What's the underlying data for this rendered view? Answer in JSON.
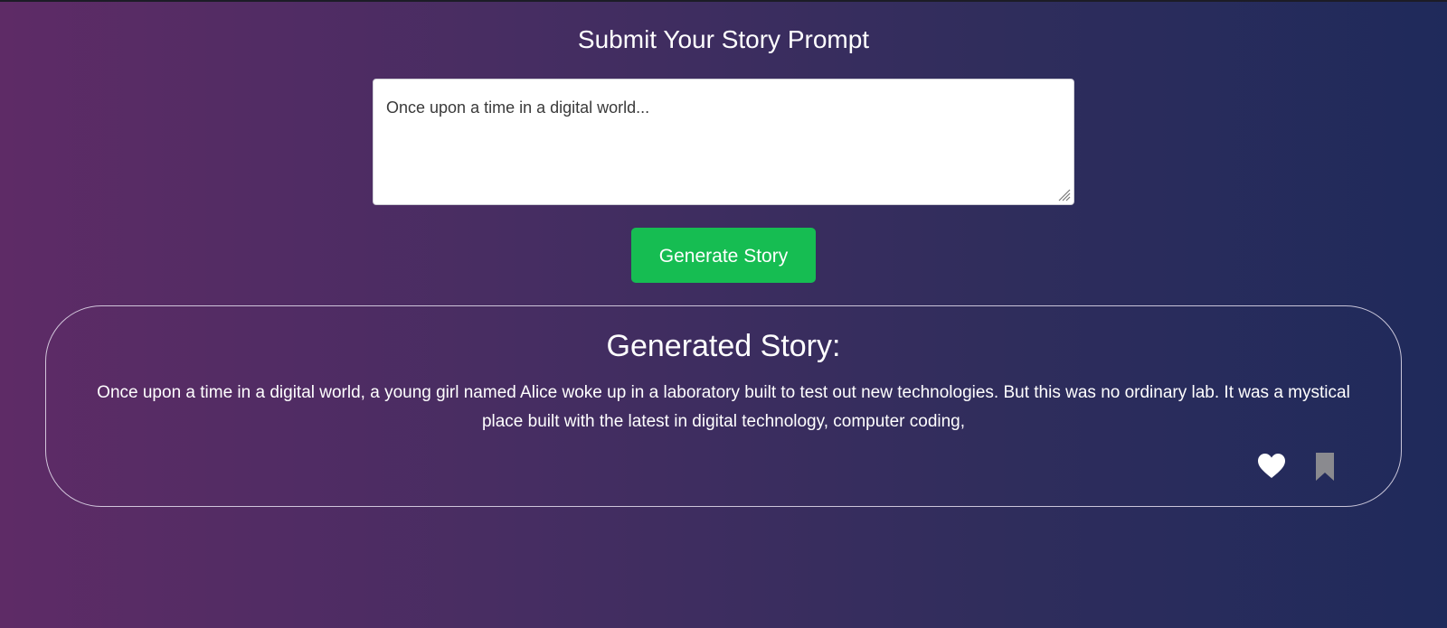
{
  "page": {
    "title": "Submit Your Story Prompt"
  },
  "prompt": {
    "value": "Once upon a time in a digital world..."
  },
  "generate_button": {
    "label": "Generate Story"
  },
  "story": {
    "heading": "Generated Story:",
    "text": "Once upon a time in a digital world, a young girl named Alice woke up in a laboratory built to test out new technologies. But this was no ordinary lab. It was a mystical place built with the latest in digital technology, computer coding,"
  },
  "actions": {
    "like_icon": "heart-icon",
    "save_icon": "bookmark-icon"
  },
  "colors": {
    "accent": "#16bd52",
    "heart": "#ffffff",
    "bookmark": "#8a8a8f"
  }
}
